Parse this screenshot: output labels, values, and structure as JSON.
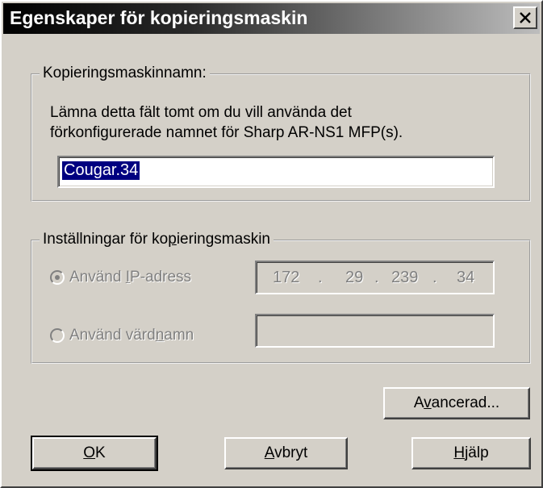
{
  "window": {
    "title": "Egenskaper för kopieringsmaskin",
    "close_glyph": "✕"
  },
  "name_group": {
    "legend": "Kopieringsmaskinnamn:",
    "description_line1": "Lämna detta fält tomt om du vill använda det",
    "description_line2": "förkonfigurerade namnet för Sharp AR-NS1 MFP(s).",
    "name_value": "Cougar.34"
  },
  "settings_group": {
    "legend_pre": "Inställningar för ko",
    "legend_accel": "p",
    "legend_post": "ieringsmaskin",
    "ip_option": {
      "pre": "Använd ",
      "accel": "I",
      "post": "P-adress",
      "selected": true,
      "enabled": false
    },
    "ip_address": [
      "172",
      "29",
      "239",
      "34"
    ],
    "ip_separator": ".",
    "hostname_option": {
      "pre": "Använd värd",
      "accel": "n",
      "post": "amn",
      "selected": false,
      "enabled": false
    },
    "hostname_value": ""
  },
  "buttons": {
    "advanced": {
      "pre": "A",
      "accel": "v",
      "post": "ancerad..."
    },
    "ok": {
      "pre": "",
      "accel": "O",
      "post": "K"
    },
    "cancel": {
      "pre": "",
      "accel": "A",
      "post": "vbryt"
    },
    "help": {
      "pre": "",
      "accel": "H",
      "post": "jälp"
    }
  }
}
